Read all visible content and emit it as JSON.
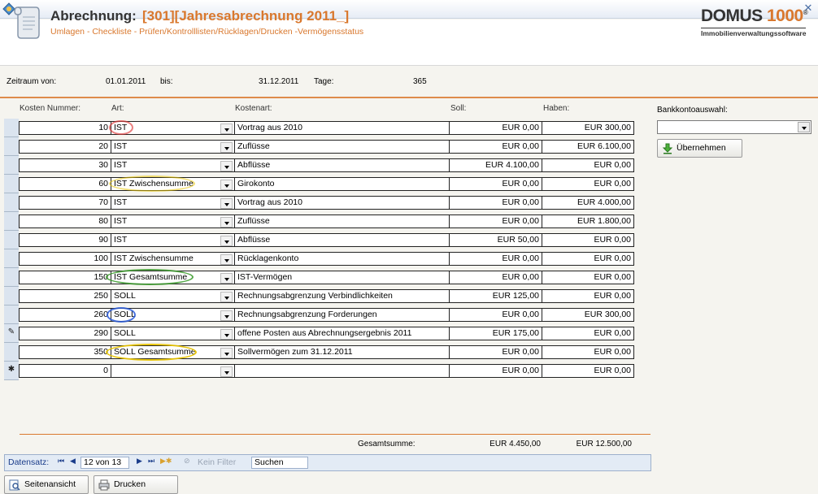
{
  "header": {
    "title_prefix": "Abrechnung:",
    "title_suffix": "[301][Jahresabrechnung 2011_]",
    "subtitle": "Umlagen - Checkliste - Prüfen/Kontrolllisten/Rücklagen/Drucken -Vermögensstatus",
    "logo_name_a": "DOMUS ",
    "logo_name_b": "1000",
    "logo_registered": "®",
    "logo_sub": "Immobilienverwaltungssoftware"
  },
  "zeitraum": {
    "von_label": "Zeitraum von:",
    "von_value": "01.01.2011",
    "bis_label": "bis:",
    "bis_value": "31.12.2011",
    "tage_label": "Tage:",
    "tage_value": "365"
  },
  "columns": {
    "kosten_nummer": "Kosten Nummer:",
    "art": "Art:",
    "kostenart": "Kostenart:",
    "soll": "Soll:",
    "haben": "Haben:"
  },
  "rows": [
    {
      "nr": "10",
      "art": "IST",
      "kostenart": "Vortrag aus 2010",
      "soll": "EUR 0,00",
      "haben": "EUR 300,00",
      "selector": ""
    },
    {
      "nr": "20",
      "art": "IST",
      "kostenart": "Zuflüsse",
      "soll": "EUR 0,00",
      "haben": "EUR 6.100,00",
      "selector": ""
    },
    {
      "nr": "30",
      "art": "IST",
      "kostenart": "Abflüsse",
      "soll": "EUR 4.100,00",
      "haben": "EUR 0,00",
      "selector": ""
    },
    {
      "nr": "60",
      "art": "IST Zwischensumme",
      "kostenart": "Girokonto",
      "soll": "EUR 0,00",
      "haben": "EUR 0,00",
      "selector": ""
    },
    {
      "nr": "70",
      "art": "IST",
      "kostenart": "Vortrag aus 2010",
      "soll": "EUR 0,00",
      "haben": "EUR 4.000,00",
      "selector": ""
    },
    {
      "nr": "80",
      "art": "IST",
      "kostenart": "Zuflüsse",
      "soll": "EUR 0,00",
      "haben": "EUR 1.800,00",
      "selector": ""
    },
    {
      "nr": "90",
      "art": "IST",
      "kostenart": "Abflüsse",
      "soll": "EUR 50,00",
      "haben": "EUR 0,00",
      "selector": ""
    },
    {
      "nr": "100",
      "art": "IST Zwischensumme",
      "kostenart": "Rücklagenkonto",
      "soll": "EUR 0,00",
      "haben": "EUR 0,00",
      "selector": ""
    },
    {
      "nr": "150",
      "art": "IST Gesamtsumme",
      "kostenart": "IST-Vermögen",
      "soll": "EUR 0,00",
      "haben": "EUR 0,00",
      "selector": ""
    },
    {
      "nr": "250",
      "art": "SOLL",
      "kostenart": "Rechnungsabgrenzung Verbindlichkeiten",
      "soll": "EUR 125,00",
      "haben": "EUR 0,00",
      "selector": ""
    },
    {
      "nr": "260",
      "art": "SOLL",
      "kostenart": "Rechnungsabgrenzung Forderungen",
      "soll": "EUR 0,00",
      "haben": "EUR 300,00",
      "selector": ""
    },
    {
      "nr": "290",
      "art": "SOLL",
      "kostenart": "offene Posten aus Abrechnungsergebnis 2011",
      "soll": "EUR 175,00",
      "haben": "EUR 0,00",
      "selector": "✎"
    },
    {
      "nr": "350",
      "art": "SOLL Gesamtsumme",
      "kostenart": "Sollvermögen zum 31.12.2011",
      "soll": "EUR 0,00",
      "haben": "EUR 0,00",
      "selector": ""
    },
    {
      "nr": "0",
      "art": "",
      "kostenart": "",
      "soll": "EUR 0,00",
      "haben": "EUR 0,00",
      "selector": "✱"
    }
  ],
  "highlight_colors": {
    "red": "#e03a3a",
    "yellow": "#e8c400",
    "green": "#3a9a2a",
    "blue": "#2a5ad8"
  },
  "totals": {
    "label": "Gesamtsumme:",
    "soll": "EUR 4.450,00",
    "haben": "EUR 12.500,00"
  },
  "navigation": {
    "datensatz_label": "Datensatz:",
    "record": "12 von 13",
    "filter_label": "Kein Filter",
    "search_label": "Suchen"
  },
  "buttons": {
    "seitenansicht": "Seitenansicht",
    "drucken": "Drucken",
    "uebernehmen": "Übernehmen"
  },
  "bank": {
    "label": "Bankkontoauswahl:",
    "value": ""
  }
}
